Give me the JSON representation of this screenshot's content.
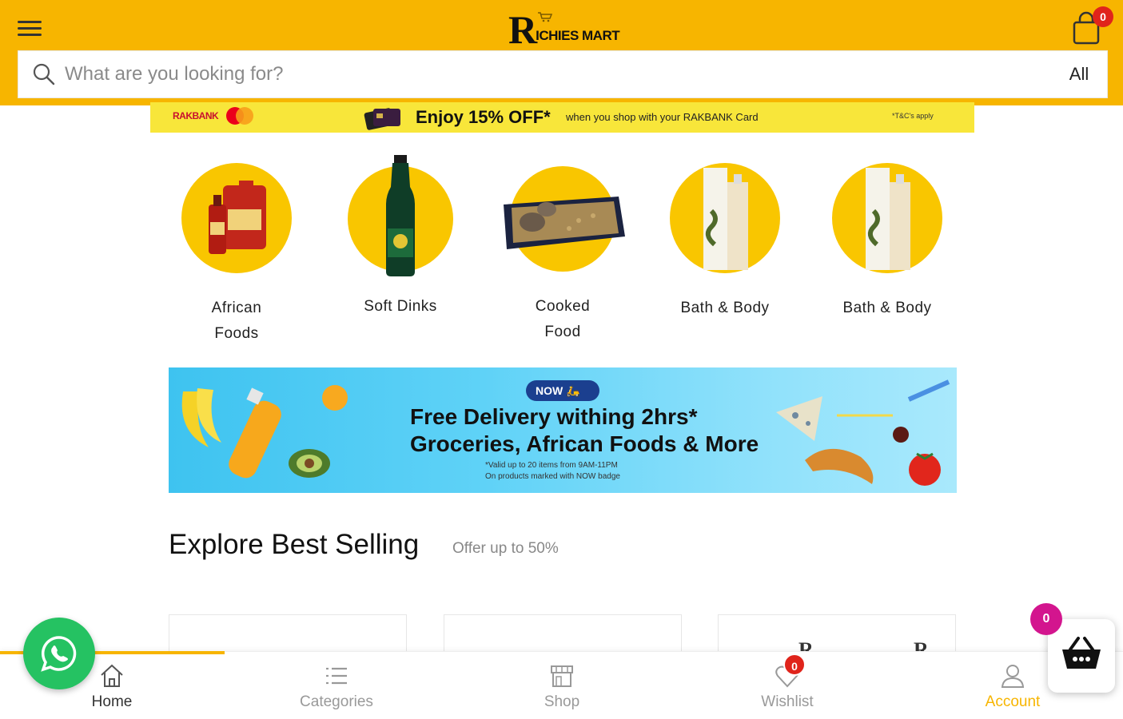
{
  "header": {
    "logo_initial": "R",
    "logo_text": "ICHIES MART",
    "cart_count": "0",
    "accent_color": "#f7b500"
  },
  "search": {
    "placeholder": "What are you looking for?",
    "filter_label": "All"
  },
  "promo_strip": {
    "bank_name": "RAKBANK",
    "headline": "Enjoy 15% OFF*",
    "subtext": "when you shop with your RAKBANK Card",
    "terms": "*T&C's apply"
  },
  "categories": [
    {
      "label_line1": "African",
      "label_line2": "Foods",
      "icon": "african-foods-icon"
    },
    {
      "label_line1": "Soft Dinks",
      "label_line2": "",
      "icon": "soft-drink-bottle-icon"
    },
    {
      "label_line1": "Cooked",
      "label_line2": "Food",
      "icon": "cooked-food-tray-icon"
    },
    {
      "label_line1": "Bath & Body",
      "label_line2": "",
      "icon": "bath-body-bottles-icon"
    },
    {
      "label_line1": "Bath & Body",
      "label_line2": "",
      "icon": "bath-body-bottles-icon"
    }
  ],
  "delivery_banner": {
    "badge": "NOW",
    "line1": "Free Delivery withing 2hrs*",
    "line2": "Groceries, African Foods & More",
    "note1": "*Valid up to 20 items from 9AM-11PM",
    "note2": "On products marked with NOW badge"
  },
  "best_selling": {
    "title": "Explore Best Selling",
    "subtitle": "Offer up to 50%"
  },
  "bottom_nav": {
    "items": [
      {
        "label": "Home",
        "icon": "home-icon"
      },
      {
        "label": "Categories",
        "icon": "list-icon"
      },
      {
        "label": "Shop",
        "icon": "shop-icon"
      },
      {
        "label": "Wishlist",
        "icon": "heart-icon"
      },
      {
        "label": "Account",
        "icon": "user-icon"
      }
    ],
    "wishlist_count": "0"
  },
  "floating": {
    "basket_count": "0",
    "whatsapp_color": "#25c262",
    "basket_badge_color": "#d3158e"
  }
}
